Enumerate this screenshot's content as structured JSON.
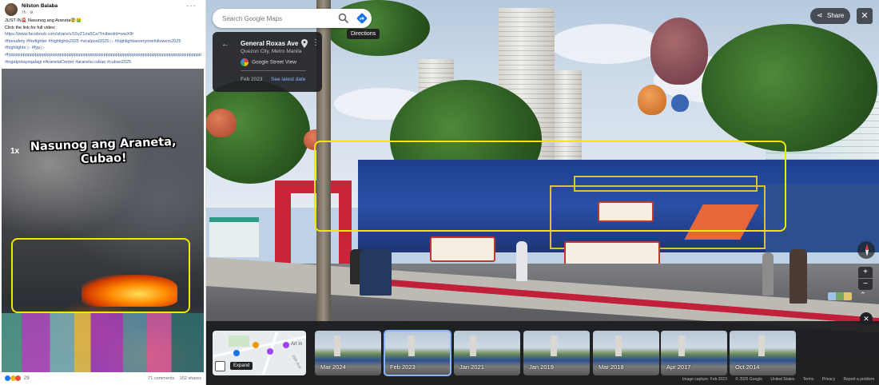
{
  "post": {
    "author": "Nilston Balaba",
    "meta": "7h · ⚙",
    "more": "···",
    "lines": [
      "JUST IN🚨 Nasunog ang Araneta😨😭",
      "Click the link for full video:",
      "https://www.facebook.com/share/v/15yZ1oa5Ce/?mibextid=wwXIfr"
    ],
    "tags": [
      "#firesafety #firefighter #highlights2025 #viralpost2025 ▷ #highlightseveryonefollowers2025",
      "#highlights ▷ #fyp ▷",
      "#fyppppppppppppppppppppppppppppppppppppppppppppppppppppppppppppppppppppppppppppppppppppppp",
      "#ingatpotayoqalagi #AranetaCenter #araneta cubao #cubao2025"
    ],
    "video_caption": "Nasunog ang Araneta, Cubao!",
    "speed": "1x",
    "reactions_count": "29",
    "comments": "71 comments",
    "shares": "152 shares"
  },
  "maps": {
    "search_placeholder": "Search Google Maps",
    "directions_tooltip": "Directions",
    "location_title": "General Roxas Ave",
    "location_sub": "Quezon City, Metro Manila",
    "gsv_label": "Google Street View",
    "date": "Feb 2023",
    "latest_link": "See latest date",
    "share_label": "Share",
    "minimap_label": "Art in",
    "minimap_street": "15th Ave",
    "expand_tooltip": "Expand",
    "thumbnails": [
      {
        "label": "Mar 2024",
        "selected": false
      },
      {
        "label": "Feb 2023",
        "selected": true
      },
      {
        "label": "Jan 2021",
        "selected": false
      },
      {
        "label": "Jan 2019",
        "selected": false
      },
      {
        "label": "Mar 2018",
        "selected": false
      },
      {
        "label": "Apr 2017",
        "selected": false
      },
      {
        "label": "Oct 2014",
        "selected": false
      }
    ],
    "footer": [
      "Image capture: Feb 2023",
      "© 2025 Google",
      "United States",
      "Terms",
      "Privacy",
      "Report a problem"
    ]
  },
  "colors": {
    "highlight": "#f2e700",
    "accent": "#8ab4f8",
    "directions": "#1a73e8"
  }
}
